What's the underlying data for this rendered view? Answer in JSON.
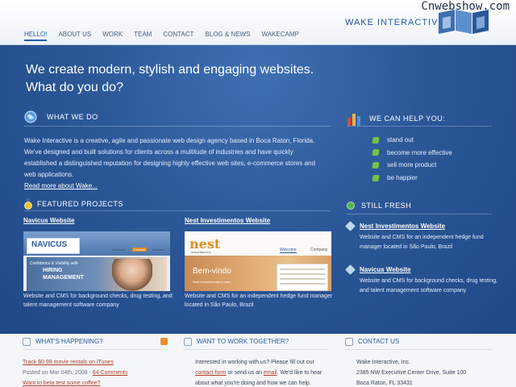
{
  "watermark": "Cnwebshow.com",
  "logo": {
    "brand": "WAKE",
    "suffix": " INTERACTIVE"
  },
  "nav": [
    {
      "label": "HELLO!",
      "active": true
    },
    {
      "label": "ABOUT US"
    },
    {
      "label": "WORK"
    },
    {
      "label": "TEAM"
    },
    {
      "label": "CONTACT"
    },
    {
      "label": "BLOG & NEWS"
    },
    {
      "label": "WAKECAMP"
    }
  ],
  "hero": {
    "line1": "We create modern, stylish and engaging websites.",
    "line2": "What do you do?"
  },
  "what_we_do": {
    "heading": "WHAT WE DO",
    "body": "Wake Interactive is a creative, agile and passionate web design agency based in Boca Raton, Florida. We've designed and built solutions for clients across a multitude of industries and have quickly established a distinguished reputation for designing highly effective web sites, e-commerce stores and web applications.",
    "more_link": "Read more about Wake..."
  },
  "help": {
    "heading": "WE CAN HELP YOU:",
    "items": [
      "stand out",
      "become more effective",
      "sell more product",
      "be happier"
    ]
  },
  "featured": {
    "heading": "FEATURED PROJECTS",
    "projects": [
      {
        "title": "Navicus Website",
        "desc": "Website and CMS for background checks, drug testing, and talent management software company",
        "thumb": {
          "logo": "NAVICUS",
          "tagline": "Confidence & Visibility with",
          "hiring": "HIRING",
          "mgmt": "MANAGEMENT",
          "tab": "Welcome",
          "tab2": "Contact",
          "tab3": "Partners"
        }
      },
      {
        "title": "Nest Investimentos Website",
        "desc": "Website and CMS for an independent hedge fund manager located in São Paulo, Brazil",
        "thumb": {
          "logo": "nest",
          "sub": "INVESTIMENTOS",
          "welcome": "Bem-vindo",
          "tab": "Welcome",
          "tab2": "Company",
          "note": "Nest Investimentos é uma..."
        }
      }
    ]
  },
  "still_fresh": {
    "heading": "STILL FRESH",
    "items": [
      {
        "title": "Nest Investimentos Website",
        "desc": "Website and CMS for an independent hedge fund manager located in São Paulo, Brazil"
      },
      {
        "title": "Navicus Website",
        "desc": "Website and CMS for background checks, drug testing, and talent management software company"
      }
    ]
  },
  "footer": {
    "happening": {
      "heading": "WHAT'S HAPPENING?",
      "post1_title": "Track $0.99 movie rentals on iTunes",
      "post1_meta": "Posted on Mar 04th, 2008 - ",
      "post1_comments": "64 Comments",
      "post2_title": "Want to beta test some coffee?"
    },
    "work": {
      "heading": "WANT TO WORK TOGETHER?",
      "t1": "Interested in working with us? Please fill out our",
      "link1": "contact form",
      "t2": " or send us an ",
      "link2": "email",
      "t3": ". We'd like to hear",
      "t4": "about what you're doing and how we can help."
    },
    "contact": {
      "heading": "CONTACT US",
      "company": "Wake Interactive, Inc.",
      "address": "2385 NW Executive Center Drive, Suite 100",
      "city": "Boca Raton, FL 33431"
    }
  },
  "colors": {
    "accent": "#1f5ea8",
    "background": "#2c5898",
    "check": "#7ac043",
    "fresh": "#53b44a"
  }
}
